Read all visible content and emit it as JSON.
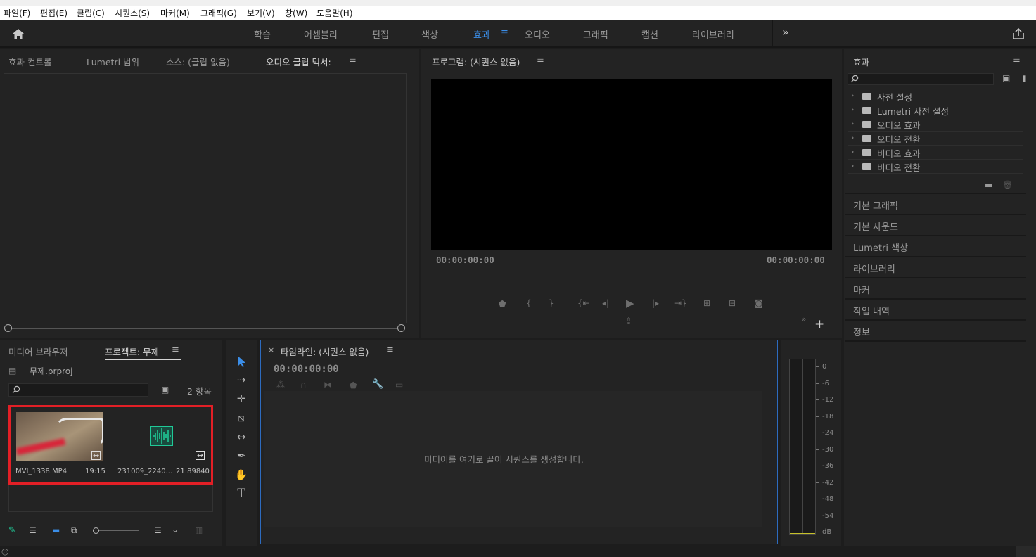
{
  "menu": [
    "파일(F)",
    "편집(E)",
    "클립(C)",
    "시퀀스(S)",
    "마커(M)",
    "그래픽(G)",
    "보기(V)",
    "창(W)",
    "도움말(H)"
  ],
  "workspaces": {
    "items": [
      "학습",
      "어셈블리",
      "편집",
      "색상",
      "효과",
      "오디오",
      "그래픽",
      "캡션",
      "라이브러리"
    ],
    "active": "효과",
    "more": "»"
  },
  "source_panel": {
    "tabs": [
      "효과 컨트롤",
      "Lumetri 범위",
      "소스: (클립 없음)",
      "오디오 클립 믹서:"
    ],
    "active_tab": "오디오 클립 믹서:"
  },
  "program_panel": {
    "title": "프로그램: (시퀀스 없음)",
    "timecode_left": "00:00:00:00",
    "timecode_right": "00:00:00:00"
  },
  "effects_panel": {
    "title": "효과",
    "search_placeholder": "",
    "tree": [
      "사전 설정",
      "Lumetri 사전 설정",
      "오디오 효과",
      "오디오 전환",
      "비디오 효과",
      "비디오 전환"
    ]
  },
  "right_panels": [
    "기본 그래픽",
    "기본 사운드",
    "Lumetri 색상",
    "라이브러리",
    "마커",
    "작업 내역",
    "정보"
  ],
  "project_panel": {
    "tabs": [
      "미디어 브라우저",
      "프로젝트: 무제"
    ],
    "active_tab": "프로젝트: 무제",
    "file": "무제.prproj",
    "count": "2 항목",
    "items": [
      {
        "name": "MVI_1338.MP4",
        "duration": "19:15"
      },
      {
        "name": "231009_2240...",
        "duration": "21:89840"
      }
    ],
    "highlight_color": "#e21f26"
  },
  "timeline_panel": {
    "title": "타임라인: (시퀀스 없음)",
    "close": "×",
    "timecode": "00:00:00:00",
    "empty_message": "미디어를 여기로 끌어 시퀀스를 생성합니다."
  },
  "audio_meter": {
    "labels": [
      "0",
      "-6",
      "-12",
      "-18",
      "-24",
      "-30",
      "-36",
      "-42",
      "-48",
      "-54",
      "dB"
    ]
  },
  "colors": {
    "accent": "#3b8ee8",
    "panel": "#232323",
    "meter_green": "#20c997"
  }
}
